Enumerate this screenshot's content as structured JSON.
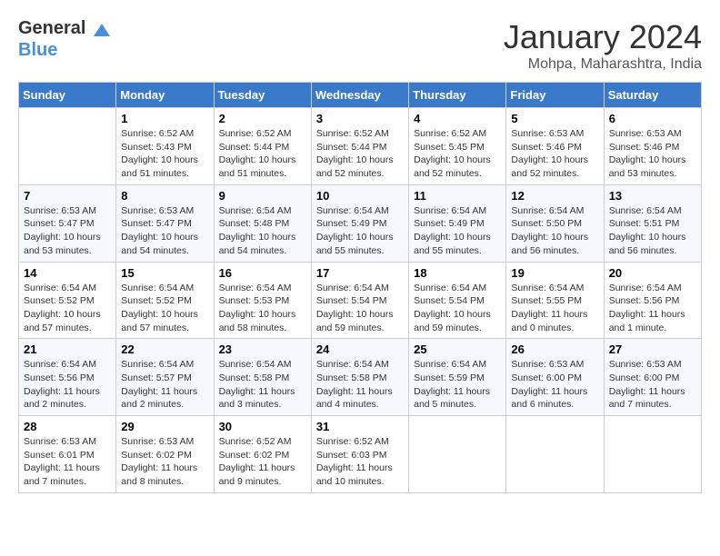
{
  "header": {
    "logo_line1": "General",
    "logo_line2": "Blue",
    "month": "January 2024",
    "location": "Mohpa, Maharashtra, India"
  },
  "days_of_week": [
    "Sunday",
    "Monday",
    "Tuesday",
    "Wednesday",
    "Thursday",
    "Friday",
    "Saturday"
  ],
  "weeks": [
    [
      {
        "day": "",
        "info": ""
      },
      {
        "day": "1",
        "info": "Sunrise: 6:52 AM\nSunset: 5:43 PM\nDaylight: 10 hours\nand 51 minutes."
      },
      {
        "day": "2",
        "info": "Sunrise: 6:52 AM\nSunset: 5:44 PM\nDaylight: 10 hours\nand 51 minutes."
      },
      {
        "day": "3",
        "info": "Sunrise: 6:52 AM\nSunset: 5:44 PM\nDaylight: 10 hours\nand 52 minutes."
      },
      {
        "day": "4",
        "info": "Sunrise: 6:52 AM\nSunset: 5:45 PM\nDaylight: 10 hours\nand 52 minutes."
      },
      {
        "day": "5",
        "info": "Sunrise: 6:53 AM\nSunset: 5:46 PM\nDaylight: 10 hours\nand 52 minutes."
      },
      {
        "day": "6",
        "info": "Sunrise: 6:53 AM\nSunset: 5:46 PM\nDaylight: 10 hours\nand 53 minutes."
      }
    ],
    [
      {
        "day": "7",
        "info": "Sunrise: 6:53 AM\nSunset: 5:47 PM\nDaylight: 10 hours\nand 53 minutes."
      },
      {
        "day": "8",
        "info": "Sunrise: 6:53 AM\nSunset: 5:47 PM\nDaylight: 10 hours\nand 54 minutes."
      },
      {
        "day": "9",
        "info": "Sunrise: 6:54 AM\nSunset: 5:48 PM\nDaylight: 10 hours\nand 54 minutes."
      },
      {
        "day": "10",
        "info": "Sunrise: 6:54 AM\nSunset: 5:49 PM\nDaylight: 10 hours\nand 55 minutes."
      },
      {
        "day": "11",
        "info": "Sunrise: 6:54 AM\nSunset: 5:49 PM\nDaylight: 10 hours\nand 55 minutes."
      },
      {
        "day": "12",
        "info": "Sunrise: 6:54 AM\nSunset: 5:50 PM\nDaylight: 10 hours\nand 56 minutes."
      },
      {
        "day": "13",
        "info": "Sunrise: 6:54 AM\nSunset: 5:51 PM\nDaylight: 10 hours\nand 56 minutes."
      }
    ],
    [
      {
        "day": "14",
        "info": "Sunrise: 6:54 AM\nSunset: 5:52 PM\nDaylight: 10 hours\nand 57 minutes."
      },
      {
        "day": "15",
        "info": "Sunrise: 6:54 AM\nSunset: 5:52 PM\nDaylight: 10 hours\nand 57 minutes."
      },
      {
        "day": "16",
        "info": "Sunrise: 6:54 AM\nSunset: 5:53 PM\nDaylight: 10 hours\nand 58 minutes."
      },
      {
        "day": "17",
        "info": "Sunrise: 6:54 AM\nSunset: 5:54 PM\nDaylight: 10 hours\nand 59 minutes."
      },
      {
        "day": "18",
        "info": "Sunrise: 6:54 AM\nSunset: 5:54 PM\nDaylight: 10 hours\nand 59 minutes."
      },
      {
        "day": "19",
        "info": "Sunrise: 6:54 AM\nSunset: 5:55 PM\nDaylight: 11 hours\nand 0 minutes."
      },
      {
        "day": "20",
        "info": "Sunrise: 6:54 AM\nSunset: 5:56 PM\nDaylight: 11 hours\nand 1 minute."
      }
    ],
    [
      {
        "day": "21",
        "info": "Sunrise: 6:54 AM\nSunset: 5:56 PM\nDaylight: 11 hours\nand 2 minutes."
      },
      {
        "day": "22",
        "info": "Sunrise: 6:54 AM\nSunset: 5:57 PM\nDaylight: 11 hours\nand 2 minutes."
      },
      {
        "day": "23",
        "info": "Sunrise: 6:54 AM\nSunset: 5:58 PM\nDaylight: 11 hours\nand 3 minutes."
      },
      {
        "day": "24",
        "info": "Sunrise: 6:54 AM\nSunset: 5:58 PM\nDaylight: 11 hours\nand 4 minutes."
      },
      {
        "day": "25",
        "info": "Sunrise: 6:54 AM\nSunset: 5:59 PM\nDaylight: 11 hours\nand 5 minutes."
      },
      {
        "day": "26",
        "info": "Sunrise: 6:53 AM\nSunset: 6:00 PM\nDaylight: 11 hours\nand 6 minutes."
      },
      {
        "day": "27",
        "info": "Sunrise: 6:53 AM\nSunset: 6:00 PM\nDaylight: 11 hours\nand 7 minutes."
      }
    ],
    [
      {
        "day": "28",
        "info": "Sunrise: 6:53 AM\nSunset: 6:01 PM\nDaylight: 11 hours\nand 7 minutes."
      },
      {
        "day": "29",
        "info": "Sunrise: 6:53 AM\nSunset: 6:02 PM\nDaylight: 11 hours\nand 8 minutes."
      },
      {
        "day": "30",
        "info": "Sunrise: 6:52 AM\nSunset: 6:02 PM\nDaylight: 11 hours\nand 9 minutes."
      },
      {
        "day": "31",
        "info": "Sunrise: 6:52 AM\nSunset: 6:03 PM\nDaylight: 11 hours\nand 10 minutes."
      },
      {
        "day": "",
        "info": ""
      },
      {
        "day": "",
        "info": ""
      },
      {
        "day": "",
        "info": ""
      }
    ]
  ]
}
